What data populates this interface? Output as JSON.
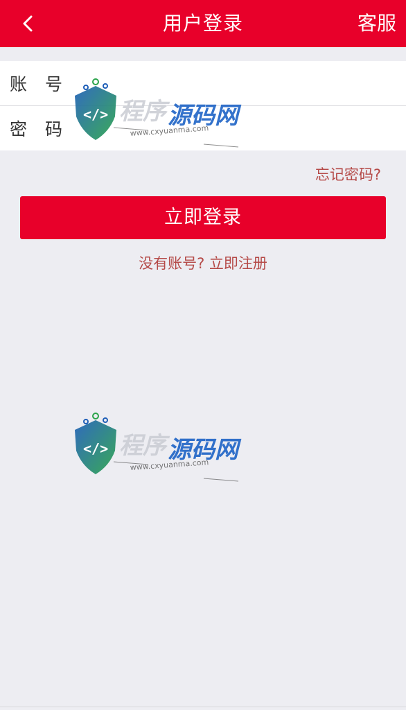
{
  "header": {
    "title": "用户登录",
    "service_label": "客服",
    "back_icon": "chevron-left-icon",
    "background_color": "#e8002a"
  },
  "form": {
    "account_label": "账号",
    "account_value": "",
    "password_label": "密码",
    "password_value": ""
  },
  "links": {
    "forgot_password": "忘记密码?",
    "register": "没有账号? 立即注册"
  },
  "buttons": {
    "login": "立即登录"
  },
  "watermark": {
    "brand": "程序源码网",
    "url": "www.cxyuanma.com"
  },
  "colors": {
    "accent": "#e8002a",
    "link": "#b54a48",
    "background": "#ededf2"
  }
}
